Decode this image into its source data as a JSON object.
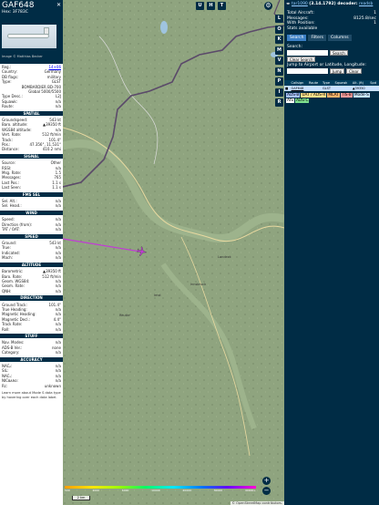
{
  "info": {
    "callsign": "GAF648",
    "hex_label": "Hex:",
    "hex": "3F783C",
    "close": "✕",
    "photo_credit": "Image © Matthias Becker",
    "rows_a": [
      {
        "k": "Reg.:",
        "v": "14+06",
        "link": true
      },
      {
        "k": "Country:",
        "v": "Germany"
      },
      {
        "k": "DB flags:",
        "v": "military"
      },
      {
        "k": "Type:",
        "v": "GLST"
      },
      {
        "k": "",
        "v": "BOMBARDIER BD-700"
      },
      {
        "k": "",
        "v": "Global 5000/5500"
      },
      {
        "k": "Type Desc.:",
        "v": "L2J"
      },
      {
        "k": "Squawk:",
        "v": "n/a"
      },
      {
        "k": "Route:",
        "v": "n/a"
      }
    ],
    "sections": [
      {
        "title": "SPATIAL",
        "rows": [
          {
            "k": "Groundspeed:",
            "v": "543 kt"
          },
          {
            "k": "Baro. altitude:",
            "v": "▲39350 ft"
          },
          {
            "k": "WGS84 altitude:",
            "v": "n/a"
          },
          {
            "k": "Vert. Rate:",
            "v": "512 ft/min"
          },
          {
            "k": "Track:",
            "v": "101.4°"
          },
          {
            "k": "Pos.:",
            "v": "47.356°, 11.531°"
          },
          {
            "k": "Distance:",
            "v": "410.2 nmi"
          }
        ]
      },
      {
        "title": "SIGNAL",
        "rows": [
          {
            "k": "Source:",
            "v": "Other"
          },
          {
            "k": "RSSI:",
            "v": "n/a"
          },
          {
            "k": "Msg. Rate:",
            "v": "1.5"
          },
          {
            "k": "Messages:",
            "v": "765"
          },
          {
            "k": "Last Pos.:",
            "v": "1.1 s"
          },
          {
            "k": "Last Seen:",
            "v": "1.1 s"
          }
        ]
      },
      {
        "title": "FMS SEL",
        "rows": [
          {
            "k": "Sel. Alt.:",
            "v": "n/a"
          },
          {
            "k": "Sel. Head.:",
            "v": "n/a"
          }
        ]
      },
      {
        "title": "WIND",
        "rows": [
          {
            "k": "Speed:",
            "v": "n/a"
          },
          {
            "k": "Direction (from):",
            "v": "n/a"
          },
          {
            "k": "TAT / OAT:",
            "v": "n/a"
          }
        ]
      },
      {
        "title": "SPEED",
        "rows": [
          {
            "k": "Ground:",
            "v": "543 kt"
          },
          {
            "k": "True:",
            "v": "n/a"
          },
          {
            "k": "Indicated:",
            "v": "n/a"
          },
          {
            "k": "Mach:",
            "v": "n/a"
          }
        ]
      },
      {
        "title": "ALTITUDE",
        "rows": [
          {
            "k": "Barometric:",
            "v": "▲39350 ft"
          },
          {
            "k": "Baro. Rate:",
            "v": "512 ft/min"
          },
          {
            "k": "Geom. WGS84:",
            "v": "n/a"
          },
          {
            "k": "Geom. Rate:",
            "v": "n/a"
          },
          {
            "k": "QNH:",
            "v": "n/a"
          }
        ]
      },
      {
        "title": "DIRECTION",
        "rows": [
          {
            "k": "Ground Track:",
            "v": "101.4°"
          },
          {
            "k": "True Heading:",
            "v": "n/a"
          },
          {
            "k": "Magnetic Heading:",
            "v": "n/a"
          },
          {
            "k": "Magnetic Decl.:",
            "v": "4.4°"
          },
          {
            "k": "Track Rate:",
            "v": "n/a"
          },
          {
            "k": "Roll:",
            "v": "n/a"
          }
        ]
      },
      {
        "title": "STUFF",
        "rows": [
          {
            "k": "Nav. Modes:",
            "v": "n/a"
          },
          {
            "k": "ADS-B Ver.:",
            "v": "none"
          },
          {
            "k": "Category:",
            "v": "n/a"
          }
        ]
      },
      {
        "title": "ACCURACY",
        "rows": [
          {
            "k": "NACₚ:",
            "v": "n/a"
          },
          {
            "k": "SIL:",
            "v": "n/a"
          },
          {
            "k": "NACᵥ:",
            "v": "n/a"
          },
          {
            "k": "NICʙᴀʀᴏ:",
            "v": "n/a"
          },
          {
            "k": "Rc:",
            "v": "unknown"
          }
        ]
      }
    ],
    "footer_note": "Learn more about Mode S data type by hovering over each data label."
  },
  "map": {
    "buttons_top": [
      "U",
      "H",
      "T"
    ],
    "side_buttons": [
      "L",
      "O",
      "K",
      "M",
      "V",
      "N",
      "P",
      "I",
      "R"
    ],
    "zoom_in": "+",
    "zoom_out": "−",
    "scale_label": "2 km",
    "attribution": "© OpenStreetMap contributors.",
    "alt_labels": [
      "500",
      "2000",
      "6000",
      "10000",
      "20000",
      "30000",
      "40000+"
    ],
    "track_color": "#c23bd6",
    "aircraft_color": "#c23bd6",
    "labels": [
      "Reutte",
      "Imst",
      "Innsbruck",
      "Landeck"
    ]
  },
  "side": {
    "title_arrow": "◂▸",
    "title_link": "tar1090",
    "title_version": "(3.14.1792) decoder:",
    "title_tail": "readsb",
    "stats": [
      {
        "k": "Total Aircraft:",
        "v": "1"
      },
      {
        "k": "Messages:",
        "v": "8125.8/sec"
      },
      {
        "k": "With Position:",
        "v": "1"
      },
      {
        "k": "Stats available",
        "v": ""
      }
    ],
    "tabs": [
      "Search",
      "Filters",
      "Columns"
    ],
    "search_label": "Search:",
    "search_btn": "Search",
    "clear_search": "Clear Search",
    "jump_label": "Jump to Airport or Latitude, Longitude:",
    "jump_btn": "Jump",
    "clear_btn": "Clear",
    "table_headers": [
      "",
      "Callsign",
      "Route",
      "Type",
      "Squawk",
      "Alt. (ft)",
      "Spd"
    ],
    "table_row": [
      "■",
      "GAF648",
      "",
      "GLST",
      "",
      "▲39350",
      ""
    ],
    "legend": [
      {
        "label": "ADS-B",
        "color": "#a8c4ff"
      },
      {
        "label": "UAT / ADS-R",
        "color": "#ffe08a"
      },
      {
        "label": "MLAT",
        "color": "#ffb36b"
      },
      {
        "label": "TIS-B",
        "color": "#ff9b9b"
      },
      {
        "label": "Mode-S",
        "color": "#c8e6ff"
      },
      {
        "label": "AIS",
        "color": "#ffffff"
      },
      {
        "label": "ADS-C",
        "color": "#7ee08e"
      }
    ]
  }
}
